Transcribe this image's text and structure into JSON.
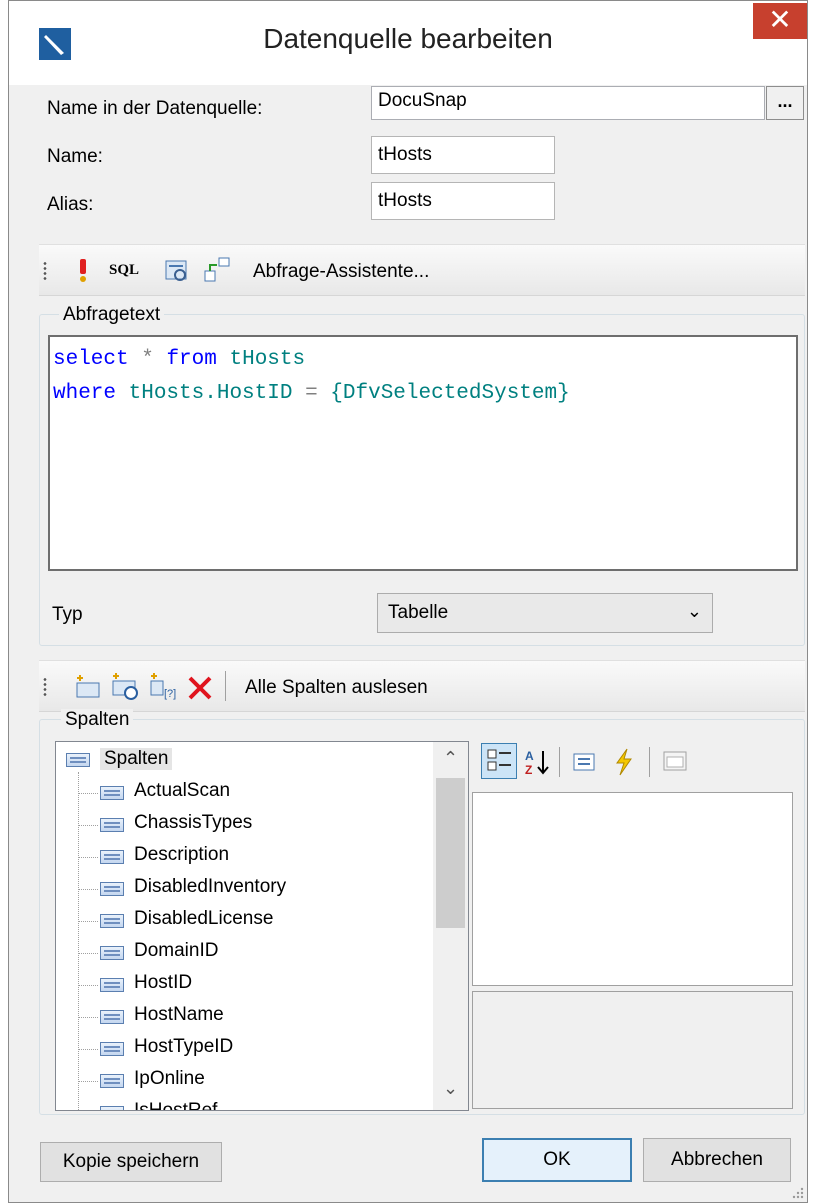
{
  "window": {
    "title": "Datenquelle bearbeiten",
    "close_glyph": "✕"
  },
  "fields": {
    "source_name_label": "Name in der Datenquelle:",
    "source_name_value": "DocuSnap",
    "browse_label": "...",
    "name_label": "Name:",
    "name_value": "tHosts",
    "alias_label": "Alias:",
    "alias_value": "tHosts"
  },
  "query_toolbar": {
    "icons": [
      "exclamation-icon",
      "sql-icon",
      "preview-icon",
      "query-builder-icon"
    ],
    "sql_text": "SQL",
    "wizard_label": "Abfrage-Assistente..."
  },
  "query_group": {
    "title": "Abfragetext",
    "sql": {
      "line1": {
        "kw1": "select",
        "op": "*",
        "kw2": "from",
        "id": "tHosts"
      },
      "line2": {
        "kw": "where",
        "id1": "tHosts.HostID",
        "op": "=",
        "id2": "{DfvSelectedSystem}"
      }
    },
    "type_label": "Typ",
    "type_value": "Tabelle"
  },
  "columns_toolbar": {
    "icons": [
      "new-column-icon",
      "new-calculated-column-icon",
      "new-parameter-icon",
      "delete-icon"
    ],
    "read_all_label": "Alle Spalten auslesen"
  },
  "columns_group": {
    "title": "Spalten",
    "root": "Spalten",
    "items": [
      "ActualScan",
      "ChassisTypes",
      "Description",
      "DisabledInventory",
      "DisabledLicense",
      "DomainID",
      "HostID",
      "HostName",
      "HostTypeID",
      "IpOnline",
      "IsHostRef"
    ]
  },
  "property_toolbar": {
    "icons": [
      "categorized-icon",
      "alphabetical-icon",
      "properties-icon",
      "events-icon",
      "property-pages-icon"
    ]
  },
  "buttons": {
    "save_copy": "Kopie speichern",
    "ok": "OK",
    "cancel": "Abbrechen"
  },
  "colors": {
    "keyword": "#0000ff",
    "identifier": "#008080",
    "operator": "#808080",
    "close": "#c7402e",
    "delete": "#e0141e"
  }
}
